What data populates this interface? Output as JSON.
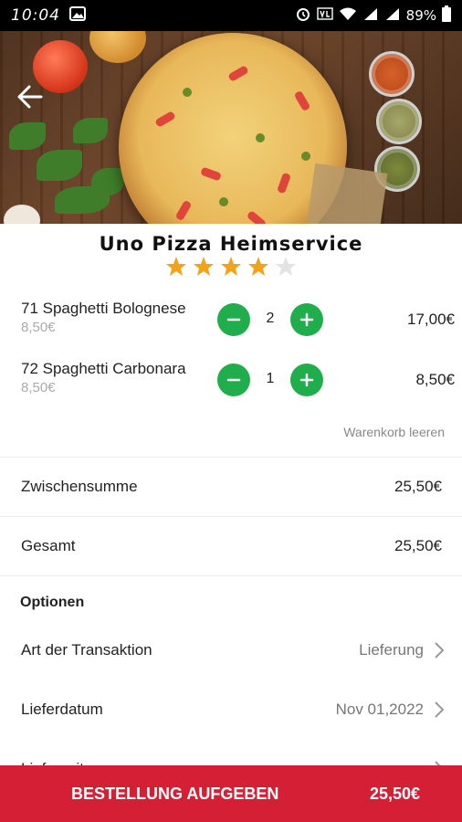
{
  "status_bar": {
    "time": "10:04",
    "battery": "89%"
  },
  "restaurant": {
    "name": "Uno Pizza Heimservice",
    "rating": 4,
    "max_rating": 5
  },
  "cart": {
    "items": [
      {
        "name": "71 Spaghetti Bolognese",
        "unit_price": "8,50€",
        "qty": "2",
        "total": "17,00€"
      },
      {
        "name": "72 Spaghetti Carbonara",
        "unit_price": "8,50€",
        "qty": "1",
        "total": "8,50€"
      }
    ],
    "clear_label": "Warenkorb leeren"
  },
  "summary": {
    "subtotal_label": "Zwischensumme",
    "subtotal_value": "25,50€",
    "total_label": "Gesamt",
    "total_value": "25,50€"
  },
  "options": {
    "title": "Optionen",
    "items": [
      {
        "label": "Art der Transaktion",
        "value": "Lieferung"
      },
      {
        "label": "Lieferdatum",
        "value": "Nov 01,2022"
      },
      {
        "label": "Lieferzeit",
        "value": ""
      }
    ]
  },
  "order_bar": {
    "label": "BESTELLUNG AUFGEBEN",
    "total": "25,50€"
  },
  "colors": {
    "accent_green": "#1fae4b",
    "order_red": "#d51f35",
    "star": "#f2a21c"
  }
}
